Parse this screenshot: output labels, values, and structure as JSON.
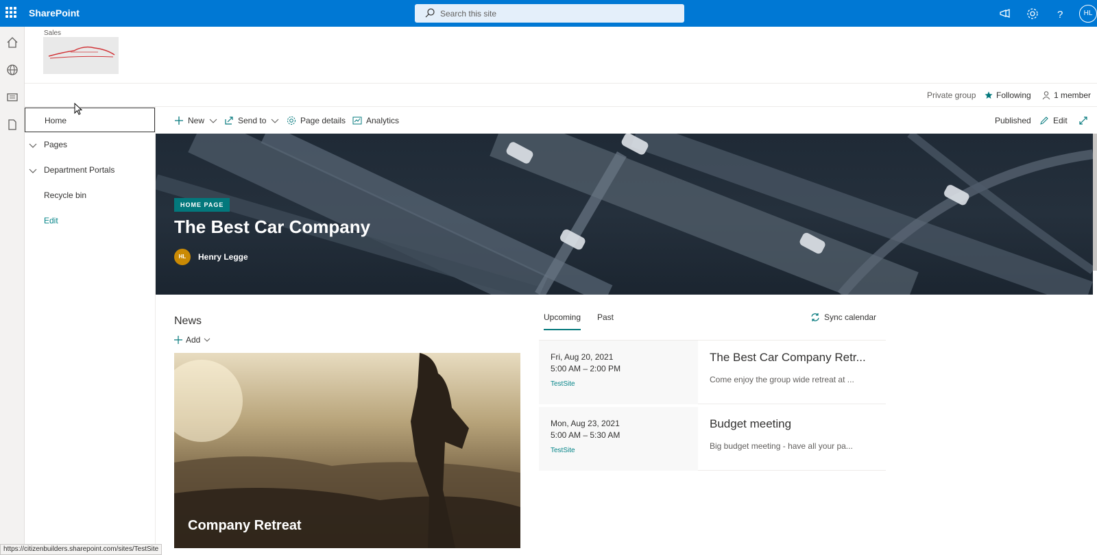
{
  "suitebar": {
    "brand": "SharePoint",
    "search_placeholder": "Search this site",
    "user_initials": "HL"
  },
  "site": {
    "name": "Sales",
    "privacy": "Private group",
    "following": "Following",
    "members": "1 member"
  },
  "nav": {
    "items": [
      {
        "label": "Home"
      },
      {
        "label": "Pages"
      },
      {
        "label": "Department Portals"
      },
      {
        "label": "Recycle bin"
      },
      {
        "label": "Edit"
      }
    ]
  },
  "commands": {
    "new": "New",
    "send_to": "Send to",
    "page_details": "Page details",
    "analytics": "Analytics",
    "published": "Published",
    "edit": "Edit"
  },
  "hero": {
    "tag": "HOME PAGE",
    "title": "The Best Car Company",
    "author_initials": "HL",
    "author": "Henry Legge"
  },
  "news": {
    "title": "News",
    "add": "Add",
    "card_title": "Company Retreat"
  },
  "events": {
    "tabs": [
      "Upcoming",
      "Past"
    ],
    "sync": "Sync calendar",
    "items": [
      {
        "date": "Fri, Aug 20, 2021",
        "time": "5:00 AM – 2:00 PM",
        "location": "TestSite",
        "title": "The Best Car Company Retr...",
        "desc": "Come enjoy the group wide retreat at ..."
      },
      {
        "date": "Mon, Aug 23, 2021",
        "time": "5:00 AM – 5:30 AM",
        "location": "TestSite",
        "title": "Budget meeting",
        "desc": "Big budget meeting - have all your pa..."
      }
    ]
  },
  "status_url": "https://citizenbuilders.sharepoint.com/sites/TestSite"
}
